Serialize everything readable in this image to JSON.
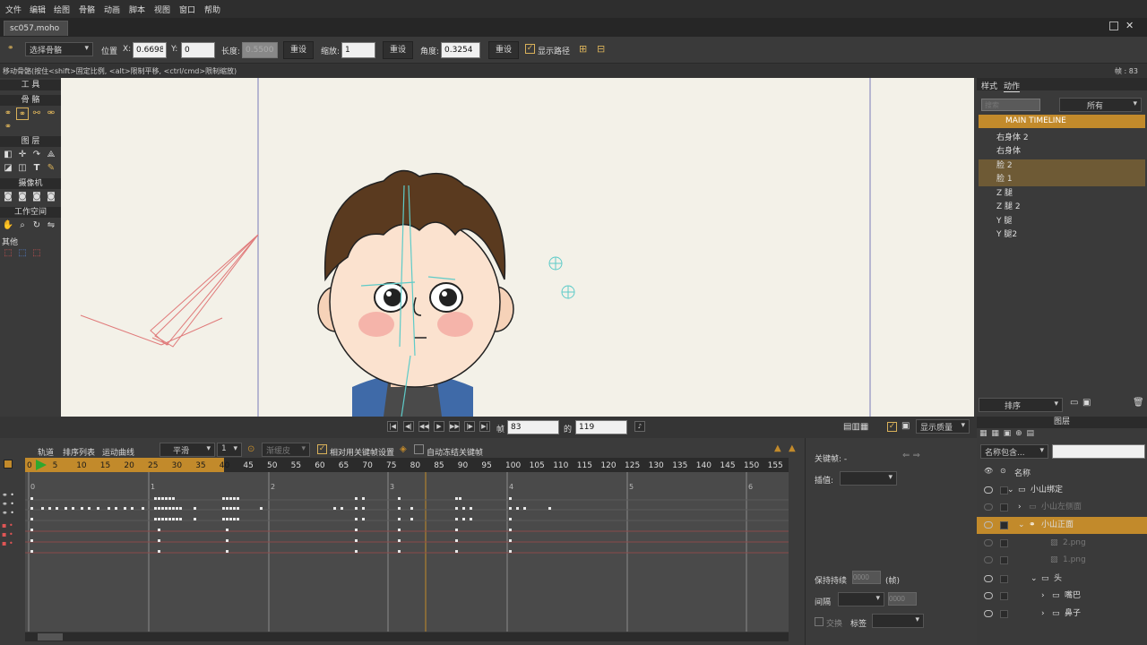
{
  "menu": [
    "文件",
    "编辑",
    "绘图",
    "骨骼",
    "动画",
    "脚本",
    "视图",
    "窗口",
    "帮助"
  ],
  "document_tab": "sc057.moho",
  "toolbar": {
    "tool_select": "选择骨骼",
    "position_label": "位置",
    "x_label": "X:",
    "x_value": "0.6698",
    "y_label": "Y:",
    "y_value": "0",
    "length_label": "长度:",
    "length_value": "0.5500",
    "reset1": "重设",
    "scale_label": "缩放:",
    "scale_value": "1",
    "reset2": "重设",
    "angle_label": "角度:",
    "angle_value": "0.3254",
    "reset3": "重设",
    "show_path": "显示路径"
  },
  "status": {
    "hint": "移动骨骼(按住<shift>固定比例, <alt>限制平移, <ctrl/cmd>限制缩放)",
    "frame_label": "帧 : 83"
  },
  "tools": {
    "title": "工 具",
    "bone": "骨 骼",
    "layer": "图 层",
    "camera": "摄像机",
    "workspace": "工作空间",
    "other": "其他"
  },
  "right_panel": {
    "tabs": [
      "样式",
      "动作"
    ],
    "search_placeholder": "搜索",
    "filter": "所有",
    "main_timeline": "MAIN TIMELINE",
    "actions": [
      "右身体 2",
      "右身体",
      "脸 2",
      "脸 1",
      "Z 腿",
      "Z 腿 2",
      "Y 腿",
      "Y 腿2"
    ],
    "sort": "排序"
  },
  "playbar": {
    "frame_label": "帧",
    "frame_value": "83",
    "of_label": "的",
    "total_value": "119",
    "display_quality": "显示质量"
  },
  "timeline": {
    "tabs": [
      "轨道",
      "排序列表",
      "运动曲线"
    ],
    "smooth": "平滑",
    "interp_value": "1",
    "ease": "渐缓皮",
    "relative_keys": "相对用关键帧设置",
    "auto_freeze": "自动冻结关键帧",
    "ruler": [
      "0",
      "5",
      "10",
      "15",
      "20",
      "25",
      "30",
      "35",
      "40",
      "45",
      "50",
      "55",
      "60",
      "65",
      "70",
      "75",
      "80",
      "85",
      "90",
      "95",
      "100",
      "105",
      "110",
      "115",
      "120",
      "125",
      "130",
      "135",
      "140",
      "145",
      "150",
      "155"
    ],
    "sections": [
      "0",
      "1",
      "2",
      "3",
      "4",
      "5",
      "6"
    ]
  },
  "properties": {
    "keyframe_label": "关键帧: -",
    "interp_label": "插值:",
    "hold_label": "保持持续",
    "hold_value": "0000",
    "hold_unit": "(帧)",
    "interval_label": "间隔",
    "interval_value": "0000",
    "loop_label": "交换",
    "tag_label": "标签"
  },
  "layers": {
    "title": "图层",
    "name_filter": "名称包含...",
    "name_header": "名称",
    "rows": [
      "小山绑定",
      "小山左侧面",
      "小山正面",
      "2.png",
      "1.png",
      "头",
      "嘴巴",
      "鼻子"
    ]
  },
  "colors": {
    "accent": "#c28a2b",
    "canvas_bg": "#f3f1e8",
    "guide_line": "#7a7ab8",
    "bone_red": "#e07a7a",
    "bone_cyan": "#5ecbc8",
    "playhead_green": "#2ea82e"
  }
}
